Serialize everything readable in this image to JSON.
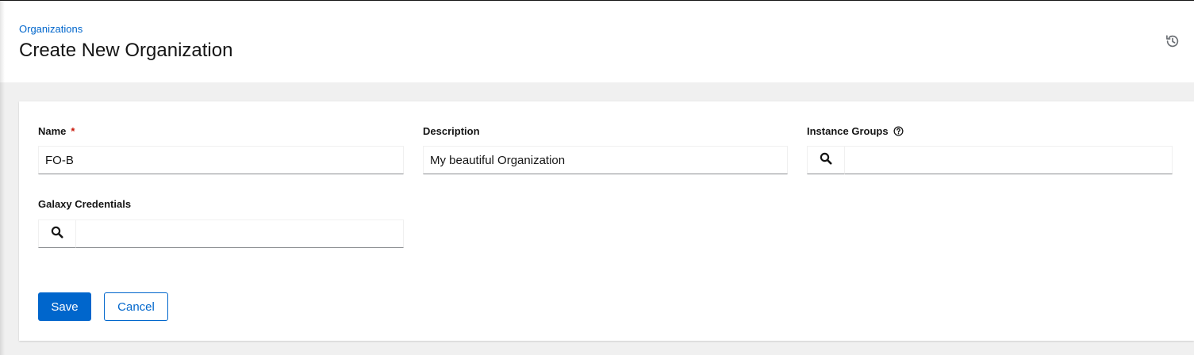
{
  "header": {
    "breadcrumb": "Organizations",
    "title": "Create New Organization",
    "history_icon": "history-icon"
  },
  "form": {
    "name": {
      "label": "Name",
      "required_mark": "*",
      "value": "FO-B"
    },
    "description": {
      "label": "Description",
      "value": "My beautiful Organization"
    },
    "instance_groups": {
      "label": "Instance Groups",
      "help_icon": "question-circle-icon",
      "search_icon": "search-icon",
      "value": ""
    },
    "galaxy_credentials": {
      "label": "Galaxy Credentials",
      "search_icon": "search-icon",
      "value": ""
    }
  },
  "actions": {
    "save_label": "Save",
    "cancel_label": "Cancel"
  },
  "colors": {
    "primary": "#0066cc",
    "required": "#c9190b",
    "background": "#f0f0f0",
    "text": "#151515"
  }
}
